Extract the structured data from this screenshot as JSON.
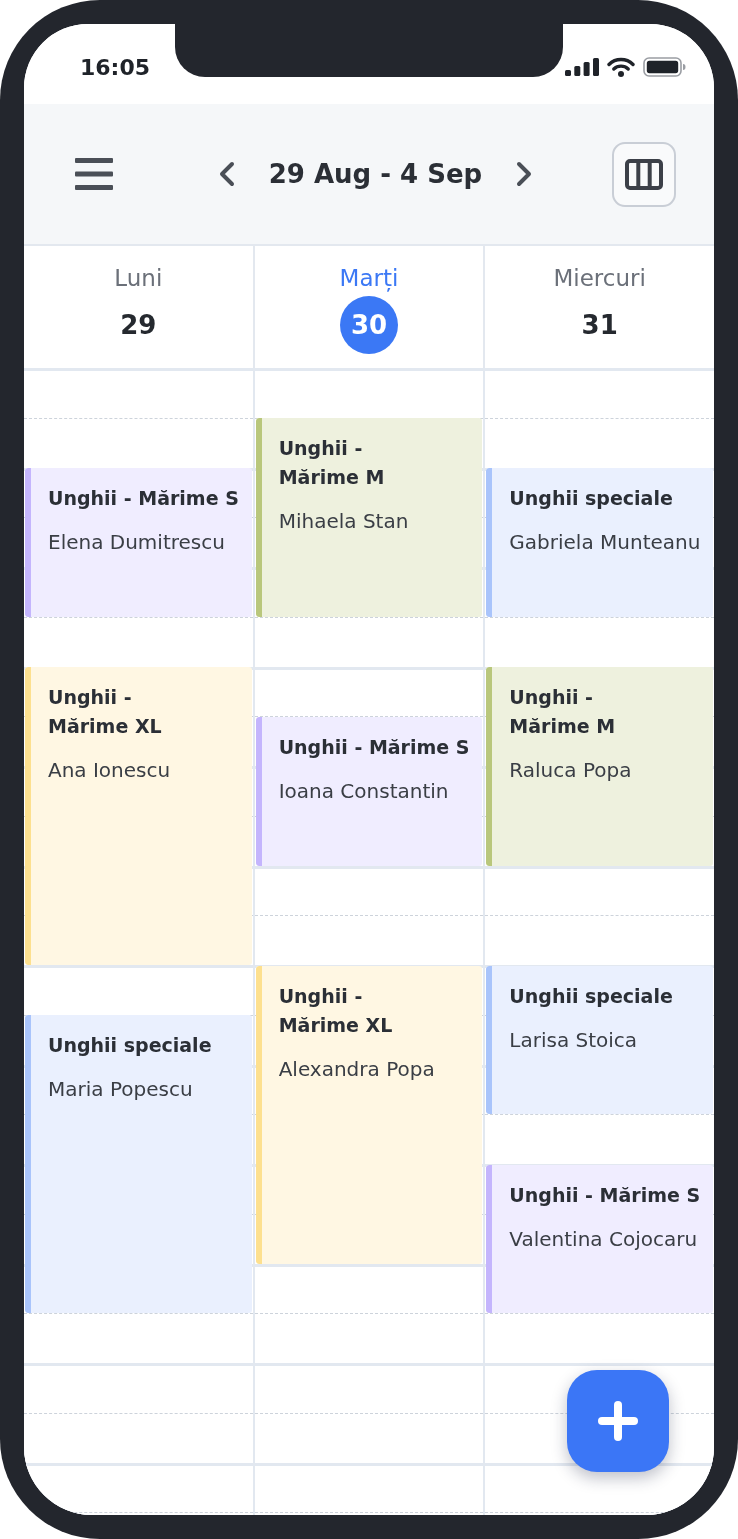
{
  "status_bar": {
    "time": "16:05"
  },
  "header": {
    "date_range": "29 Aug - 4 Sep"
  },
  "days": [
    {
      "name": "Luni",
      "number": "29",
      "selected": false,
      "events": [
        {
          "title": "Unghii - Mărime S",
          "client": "Elena Dumitrescu",
          "color": "#c4b5fd"
        },
        {
          "title": "Unghii - Mărime XL",
          "client": "Ana Ionescu",
          "color": "#fde08f"
        },
        {
          "title": "Unghii speciale",
          "client": "Maria Popescu",
          "color": "#a9c4fb"
        }
      ]
    },
    {
      "name": "Marți",
      "number": "30",
      "selected": true,
      "events": [
        {
          "title": "Unghii - Mărime M",
          "client": "Mihaela Stan",
          "color": "#b9c77c"
        },
        {
          "title": "Unghii - Mărime S",
          "client": "Ioana Constantin",
          "color": "#c4b5fd"
        },
        {
          "title": "Unghii - Mărime XL",
          "client": "Alexandra Popa",
          "color": "#fde08f"
        }
      ]
    },
    {
      "name": "Miercuri",
      "number": "31",
      "selected": false,
      "events": [
        {
          "title": "Unghii speciale",
          "client": "Gabriela Munteanu",
          "color": "#a9c4fb"
        },
        {
          "title": "Unghii - Mărime M",
          "client": "Raluca Popa",
          "color": "#b9c77c"
        },
        {
          "title": "Unghii speciale",
          "client": "Larisa Stoica",
          "color": "#a9c4fb"
        },
        {
          "title": "Unghii - Mărime S",
          "client": "Valentina Cojocaru",
          "color": "#c4b5fd"
        }
      ]
    }
  ]
}
